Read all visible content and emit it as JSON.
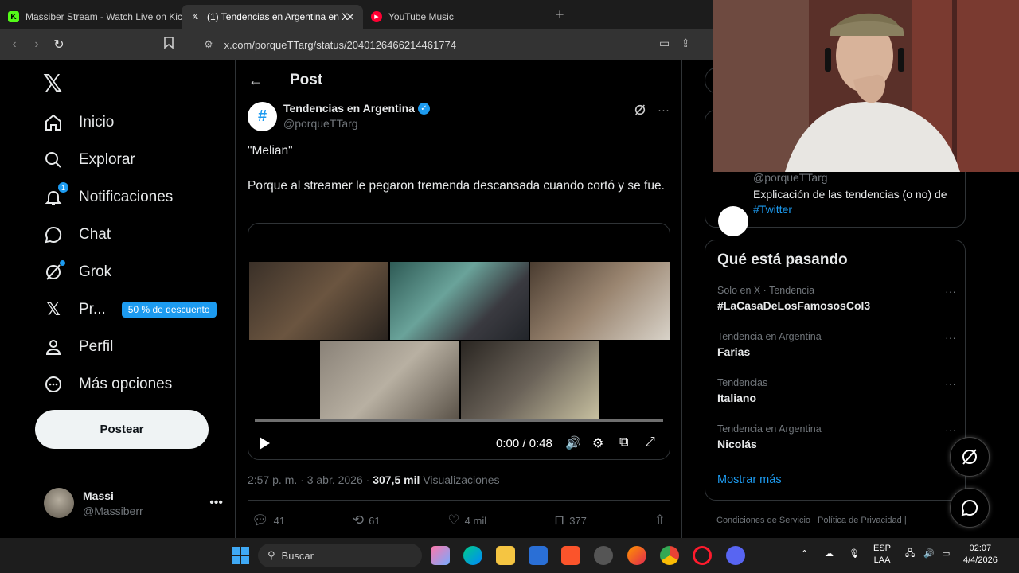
{
  "browser": {
    "tabs": [
      {
        "title": "Massiber Stream - Watch Live on Kick",
        "favicon": "kick-icon",
        "active": false
      },
      {
        "title": "(1) Tendencias en Argentina en X",
        "favicon": "x-icon",
        "active": true
      },
      {
        "title": "YouTube Music",
        "favicon": "youtube-music-icon",
        "active": false
      }
    ],
    "new_tab": "+",
    "url": "x.com/porqueTTarg/status/2040126466214461774"
  },
  "nav": {
    "items": [
      {
        "label": "Inicio",
        "icon": "home-icon"
      },
      {
        "label": "Explorar",
        "icon": "search-icon"
      },
      {
        "label": "Notificaciones",
        "icon": "bell-icon",
        "badge": "1"
      },
      {
        "label": "Chat",
        "icon": "chat-icon"
      },
      {
        "label": "Grok",
        "icon": "grok-icon"
      },
      {
        "label": "Pr...",
        "icon": "x-premium-icon",
        "promo": "50 % de descuento"
      },
      {
        "label": "Perfil",
        "icon": "person-icon"
      },
      {
        "label": "Más opciones",
        "icon": "more-circle-icon"
      }
    ],
    "post_button": "Postear",
    "user": {
      "name": "Massi",
      "handle": "@Massiberr"
    }
  },
  "post": {
    "header": "Post",
    "author_name": "Tendencias en Argentina",
    "author_handle": "@porqueTTarg",
    "quote": "\"Melian\"",
    "body": "Porque al streamer le pegaron tremenda descansada cuando cortó y se fue.",
    "video_time": "0:00 / 0:48",
    "video_progress": 0,
    "timestamp": "2:57 p. m. · 3 abr. 2026 · ",
    "views_count": "307,5 mil",
    "views_label": " Visualizaciones",
    "replies": "41",
    "reposts": "61",
    "likes": "4 mil",
    "bookmarks": "377"
  },
  "sidebar": {
    "about_handle": "@porqueTTarg",
    "about_desc": "Explicación de las tendencias (o no) de",
    "about_tag": "#Twitter",
    "trends_title": "Qué está pasando",
    "trends": [
      {
        "context": "Solo en X · Tendencia",
        "name": "#LaCasaDeLosFamososCol3"
      },
      {
        "context": "Tendencia en Argentina",
        "name": "Farias"
      },
      {
        "context": "Tendencias",
        "name": "Italiano"
      },
      {
        "context": "Tendencia en Argentina",
        "name": "Nicolás"
      }
    ],
    "show_more": "Mostrar más",
    "footer": "Condiciones de Servicio   |   Política de Privacidad   |"
  },
  "taskbar": {
    "search_placeholder": "Buscar",
    "lang": "ESP",
    "layout": "LAA",
    "time": "02:07",
    "date": "4/4/2026"
  },
  "colors": {
    "accent": "#1d9bf0",
    "background": "#000000",
    "border": "#2f3336",
    "muted": "#71767b"
  }
}
